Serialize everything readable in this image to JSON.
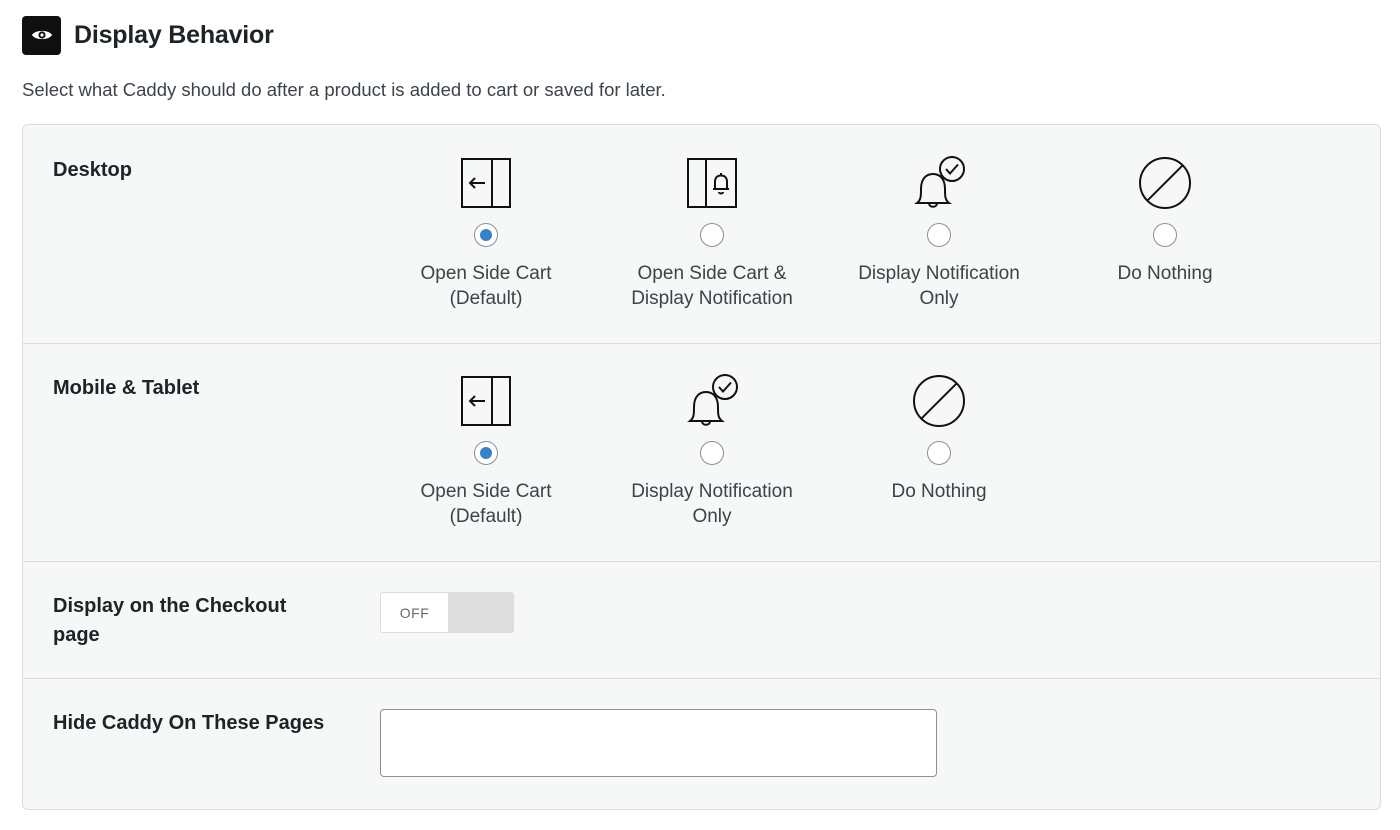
{
  "header": {
    "icon": "eye-icon",
    "title": "Display Behavior",
    "subtitle": "Select what Caddy should do after a product is added to cart or saved for later."
  },
  "desktop": {
    "label": "Desktop",
    "options": [
      {
        "icon": "side-cart-icon",
        "label": "Open Side Cart\n(Default)",
        "selected": true
      },
      {
        "icon": "side-cart-notification-icon",
        "label": "Open Side Cart &\nDisplay Notification",
        "selected": false
      },
      {
        "icon": "bell-check-icon",
        "label": "Display Notification\nOnly",
        "selected": false
      },
      {
        "icon": "prohibited-icon",
        "label": "Do Nothing",
        "selected": false
      }
    ]
  },
  "mobile": {
    "label": "Mobile & Tablet",
    "options": [
      {
        "icon": "side-cart-icon",
        "label": "Open Side Cart\n(Default)",
        "selected": true
      },
      {
        "icon": "bell-check-icon",
        "label": "Display Notification\nOnly",
        "selected": false
      },
      {
        "icon": "prohibited-icon",
        "label": "Do Nothing",
        "selected": false
      }
    ]
  },
  "checkout": {
    "label": "Display on the Checkout page",
    "toggle_label": "OFF",
    "enabled": false
  },
  "hide_pages": {
    "label": "Hide Caddy On These Pages",
    "value": "",
    "placeholder": ""
  },
  "colors": {
    "accent": "#3582c4",
    "panel_bg": "#f6f7f7",
    "border": "#dcdcde"
  }
}
